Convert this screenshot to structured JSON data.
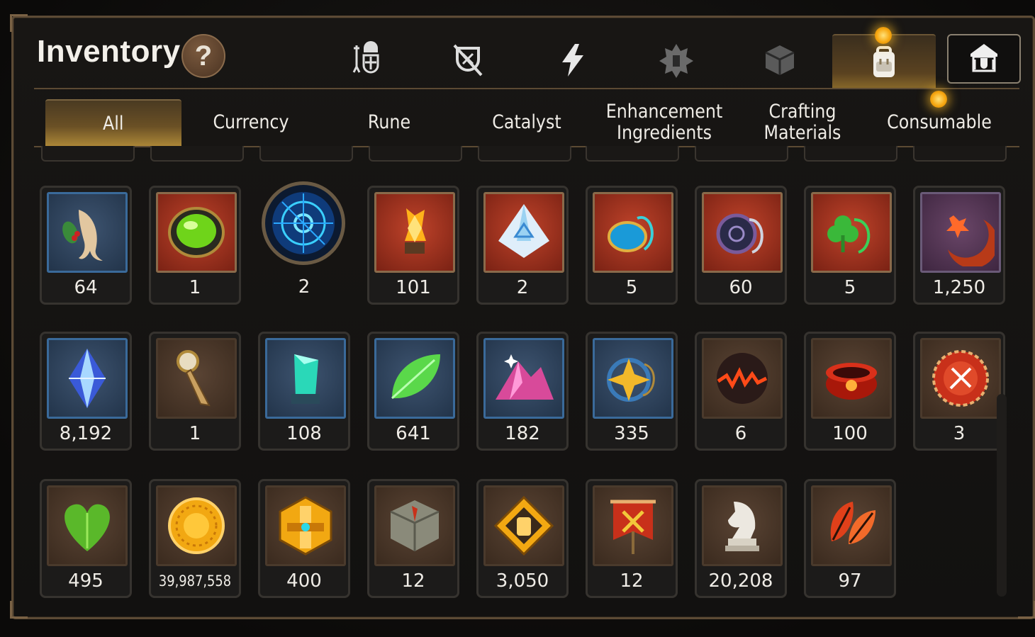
{
  "header": {
    "title": "Inventory",
    "help_label": "?"
  },
  "categories": [
    "equipment-icon",
    "broken-shield-icon",
    "lightning-icon",
    "rune-crest-icon",
    "cube-icon",
    "backpack-icon",
    "guild-crest-icon"
  ],
  "active_category": "backpack-icon",
  "tabs": [
    {
      "label": "All"
    },
    {
      "label": "Currency"
    },
    {
      "label": "Rune"
    },
    {
      "label": "Catalyst"
    },
    {
      "label": "Enhancement\nIngredients"
    },
    {
      "label": "Crafting\nMaterials"
    },
    {
      "label": "Consumable"
    }
  ],
  "active_tab": "All",
  "items": {
    "row1": [
      {
        "icon": "ginseng-root-icon",
        "count": "64"
      },
      {
        "icon": "green-gem-icon",
        "count": "1"
      },
      {
        "icon": "blue-rune-disc-icon",
        "count": "2"
      },
      {
        "icon": "amber-crystal-icon",
        "count": "101"
      },
      {
        "icon": "triangle-crystal-icon",
        "count": "2"
      },
      {
        "icon": "blue-pendant-icon",
        "count": "5"
      },
      {
        "icon": "dark-ring-pendant-icon",
        "count": "60"
      },
      {
        "icon": "clover-pendant-icon",
        "count": "5"
      },
      {
        "icon": "red-crescent-icon",
        "count": "1,250"
      }
    ],
    "row2": [
      {
        "icon": "blue-diamond-icon",
        "count": "8,192"
      },
      {
        "icon": "compass-key-icon",
        "count": "1"
      },
      {
        "icon": "teal-crystal-icon",
        "count": "108"
      },
      {
        "icon": "green-leaf-icon",
        "count": "641"
      },
      {
        "icon": "pink-mountain-icon",
        "count": "182"
      },
      {
        "icon": "star-pendant-icon",
        "count": "335"
      },
      {
        "icon": "lava-orb-icon",
        "count": "6"
      },
      {
        "icon": "red-ring-icon",
        "count": "100"
      },
      {
        "icon": "seal-badge-icon",
        "count": "3"
      }
    ],
    "row3": [
      {
        "icon": "green-heart-icon",
        "count": "495"
      },
      {
        "icon": "gold-coin-icon",
        "count": "39,987,558"
      },
      {
        "icon": "gold-hex-badge-icon",
        "count": "400"
      },
      {
        "icon": "stone-compass-icon",
        "count": "12"
      },
      {
        "icon": "fist-emblem-icon",
        "count": "3,050"
      },
      {
        "icon": "war-banner-icon",
        "count": "12"
      },
      {
        "icon": "knight-piece-icon",
        "count": "20,208"
      },
      {
        "icon": "autumn-leaves-icon",
        "count": "97"
      }
    ]
  }
}
